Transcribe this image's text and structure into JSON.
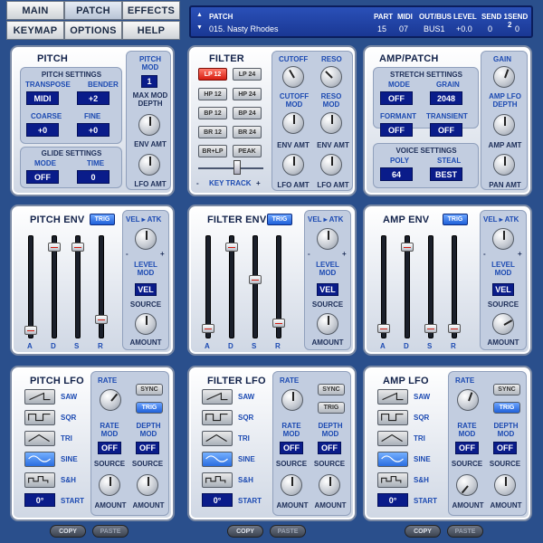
{
  "nav": {
    "main": "MAIN",
    "patch": "PATCH",
    "effects": "EFFECTS",
    "keymap": "KEYMAP",
    "options": "OPTIONS",
    "help": "HELP"
  },
  "display": {
    "label": "PATCH",
    "name": "015. Nasty Rhodes",
    "cols": [
      "PART",
      "MIDI",
      "OUT/BUS",
      "LEVEL",
      "SEND 1",
      "SEND 2"
    ],
    "vals": [
      "15",
      "07",
      "BUS1",
      "+0.0",
      "0",
      "0"
    ]
  },
  "pitch": {
    "title": "PITCH",
    "settings": "PITCH SETTINGS",
    "transpose": "TRANSPOSE",
    "bender": "BENDER",
    "transpose_val": "MIDI",
    "bender_val": "+2",
    "coarse": "COARSE",
    "fine": "FINE",
    "coarse_val": "+0",
    "fine_val": "+0",
    "glide": "GLIDE SETTINGS",
    "mode": "MODE",
    "time": "TIME",
    "mode_val": "OFF",
    "time_val": "0",
    "mod": "PITCH MOD",
    "mod_val": "1",
    "maxmod": "MAX MOD DEPTH",
    "envamt": "ENV AMT",
    "lfoamt": "LFO AMT"
  },
  "filter": {
    "title": "FILTER",
    "types": [
      "LP 12",
      "LP 24",
      "HP 12",
      "HP 24",
      "BP 12",
      "BP 24",
      "BR 12",
      "BR 24",
      "BR+LP",
      "PEAK"
    ],
    "keytrack": "KEY TRACK",
    "minus": "-",
    "plus": "+",
    "cutoff": "CUTOFF",
    "reso": "RESO",
    "cutoffmod": "CUTOFF MOD",
    "resomod": "RESO MOD",
    "envamt": "ENV AMT",
    "lfoamt": "LFO AMT"
  },
  "amp": {
    "title": "AMP/PATCH",
    "stretch": "STRETCH SETTINGS",
    "mode": "MODE",
    "grain": "GRAIN",
    "mode_val": "OFF",
    "grain_val": "2048",
    "formant": "FORMANT",
    "transient": "TRANSIENT",
    "formant_val": "OFF",
    "transient_val": "OFF",
    "voice": "VOICE SETTINGS",
    "poly": "POLY",
    "steal": "STEAL",
    "poly_val": "64",
    "steal_val": "BEST",
    "gain": "GAIN",
    "lfodepth": "AMP LFO DEPTH",
    "ampamt": "AMP AMT",
    "panamt": "PAN AMT"
  },
  "env": {
    "trig": "TRIG",
    "velatk": "VEL ▸ ATK",
    "minus": "-",
    "plus": "+",
    "levelmod": "LEVEL MOD",
    "vel": "VEL",
    "source": "SOURCE",
    "amount": "AMOUNT",
    "a": "A",
    "d": "D",
    "s": "S",
    "r": "R",
    "titles": [
      "PITCH ENV",
      "FILTER ENV",
      "AMP ENV"
    ]
  },
  "lfo": {
    "titles": [
      "PITCH LFO",
      "FILTER LFO",
      "AMP LFO"
    ],
    "waves": [
      "SAW",
      "SQR",
      "TRI",
      "SINE",
      "S&H"
    ],
    "start": "START",
    "start_val": "0°",
    "rate": "RATE",
    "sync": "SYNC",
    "trig": "TRIG",
    "ratemod": "RATE MOD",
    "depthmod": "DEPTH MOD",
    "off": "OFF",
    "source": "SOURCE",
    "amount": "AMOUNT"
  },
  "bottom": {
    "copy": "COPY",
    "paste": "PASTE"
  }
}
